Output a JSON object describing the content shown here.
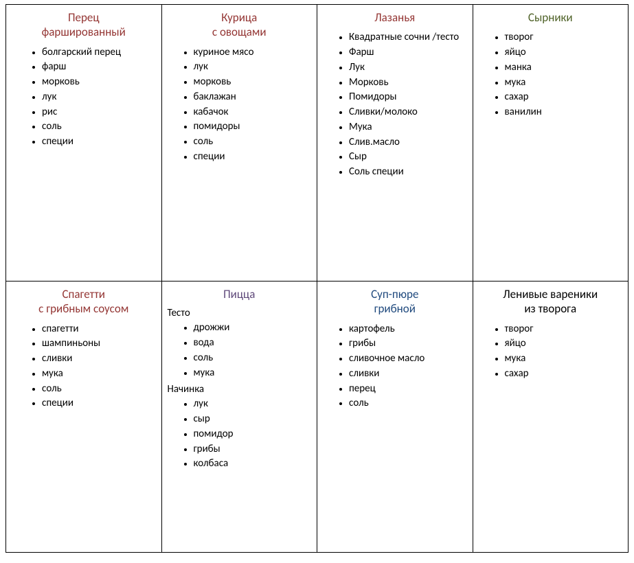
{
  "cells": [
    {
      "id": "cell-0",
      "title": "Перец\nфаршированный",
      "titleColor": "brown",
      "pad": "",
      "groups": [
        {
          "heading": null,
          "items": [
            "болгарский перец",
            "фарш",
            "морковь",
            "лук",
            "рис",
            "соль",
            "специи"
          ]
        }
      ]
    },
    {
      "id": "cell-1",
      "title": "Курица\nс овощами",
      "titleColor": "brown",
      "pad": "pad-narrow",
      "groups": [
        {
          "heading": null,
          "items": [
            "куриное мясо",
            "лук",
            "морковь",
            "баклажан",
            "кабачок",
            "помидоры",
            "соль",
            "специи"
          ]
        }
      ]
    },
    {
      "id": "cell-2",
      "title": "Лазанья",
      "titleColor": "brown",
      "pad": "pad-narrow",
      "groups": [
        {
          "heading": null,
          "items": [
            "Квадратные сочни /тесто",
            "Фарш",
            "Лук",
            "Морковь",
            "Помидоры",
            "Сливки/молоко",
            "Мука",
            "Слив.масло",
            "Сыр",
            "Соль специи"
          ]
        }
      ]
    },
    {
      "id": "cell-3",
      "title": "Сырники",
      "titleColor": "green",
      "pad": "pad-narrow",
      "groups": [
        {
          "heading": null,
          "items": [
            "творог",
            "яйцо",
            "манка",
            "мука",
            "сахар",
            "ванилин"
          ]
        }
      ]
    },
    {
      "id": "cell-4",
      "title": "Спагетти\nс грибным соусом",
      "titleColor": "brown",
      "pad": "",
      "groups": [
        {
          "heading": null,
          "items": [
            "спагетти",
            "шампиньоны",
            "сливки",
            "мука",
            "соль",
            "специи"
          ]
        }
      ]
    },
    {
      "id": "cell-5",
      "title": "Пицца",
      "titleColor": "purple",
      "pad": "pad-narrow",
      "groups": [
        {
          "heading": "Тесто",
          "items": [
            "дрожжи",
            "вода",
            "соль",
            "мука"
          ]
        },
        {
          "heading": "Начинка",
          "items": [
            "лук",
            "сыр",
            "помидор",
            "грибы",
            "колбаса"
          ]
        }
      ]
    },
    {
      "id": "cell-6",
      "title": "Суп-пюре\nгрибной",
      "titleColor": "blue",
      "pad": "pad-narrow",
      "groups": [
        {
          "heading": null,
          "items": [
            "картофель",
            "грибы",
            "сливочное масло",
            "сливки",
            "перец",
            "соль"
          ]
        }
      ]
    },
    {
      "id": "cell-7",
      "title": "Ленивые вареники\nиз творога",
      "titleColor": "black",
      "pad": "pad-narrow",
      "groups": [
        {
          "heading": null,
          "items": [
            "творог",
            "яйцо",
            "мука",
            "сахар"
          ]
        }
      ]
    }
  ]
}
